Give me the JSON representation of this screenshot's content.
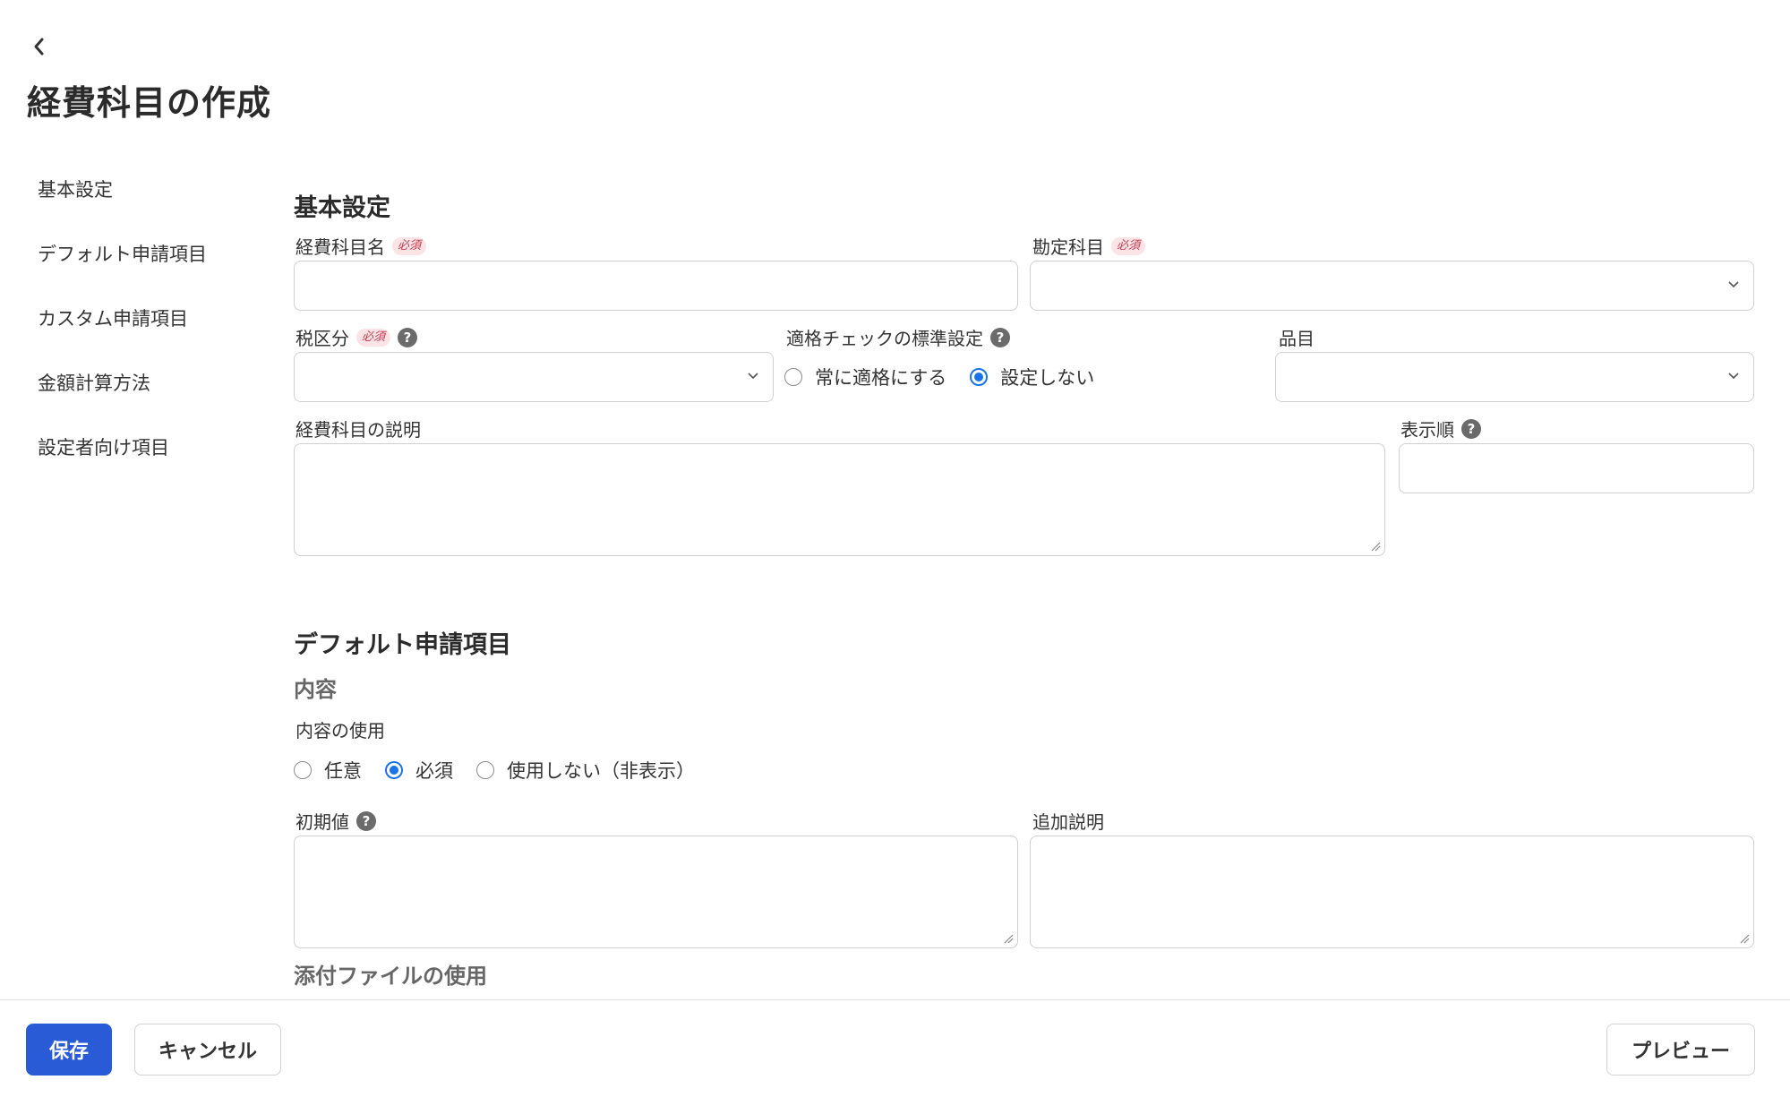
{
  "header": {
    "back_icon": "chevron-left-icon",
    "title": "経費科目の作成"
  },
  "sidebar": {
    "items": [
      {
        "label": "基本設定"
      },
      {
        "label": "デフォルト申請項目"
      },
      {
        "label": "カスタム申請項目"
      },
      {
        "label": "金額計算方法"
      },
      {
        "label": "設定者向け項目"
      }
    ]
  },
  "basic": {
    "title": "基本設定",
    "required_badge": "必須",
    "expense_name": {
      "label": "経費科目名",
      "value": ""
    },
    "account": {
      "label": "勘定科目",
      "value": ""
    },
    "tax": {
      "label": "税区分",
      "value": ""
    },
    "qualified": {
      "label": "適格チェックの標準設定",
      "options": [
        {
          "label": "常に適格にする",
          "checked": false
        },
        {
          "label": "設定しない",
          "checked": true
        }
      ]
    },
    "item": {
      "label": "品目",
      "value": ""
    },
    "description": {
      "label": "経費科目の説明",
      "value": ""
    },
    "order": {
      "label": "表示順",
      "value": ""
    }
  },
  "default_fields": {
    "title": "デフォルト申請項目",
    "content": {
      "title": "内容",
      "usage_label": "内容の使用",
      "options": [
        {
          "label": "任意",
          "checked": false
        },
        {
          "label": "必須",
          "checked": true
        },
        {
          "label": "使用しない（非表示）",
          "checked": false
        }
      ]
    },
    "initial": {
      "label": "初期値",
      "value": ""
    },
    "extra": {
      "label": "追加説明",
      "value": ""
    },
    "attachment_title": "添付ファイルの使用"
  },
  "footer": {
    "save_label": "保存",
    "cancel_label": "キャンセル",
    "preview_label": "プレビュー"
  },
  "colors": {
    "primary": "#2a5bd7",
    "radio_checked": "#1a73e8",
    "required_badge_bg": "#fbe3e6",
    "required_badge_text": "#c23b4e"
  }
}
